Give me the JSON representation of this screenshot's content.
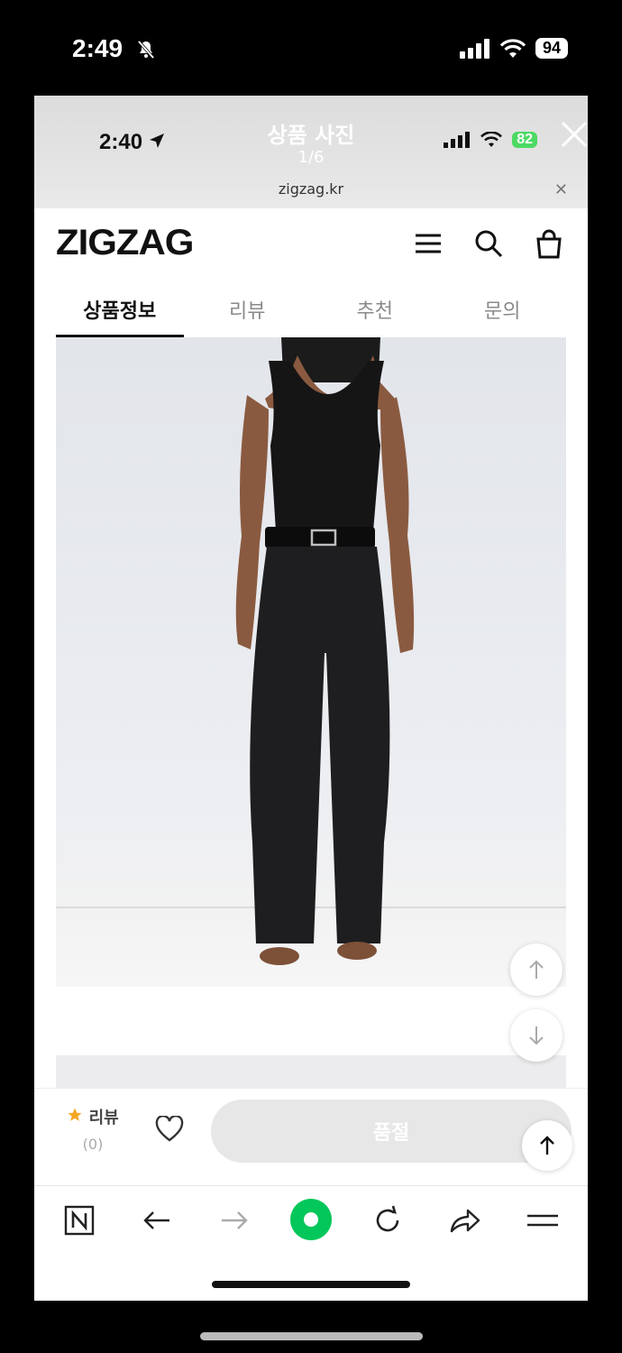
{
  "outer_status": {
    "time": "2:49",
    "battery": "94"
  },
  "viewer": {
    "time": "2:40",
    "title": "상품 사진",
    "counter": "1/6",
    "battery": "82",
    "url": "zigzag.kr"
  },
  "site": {
    "logo": "ZIGZAG",
    "tabs": [
      {
        "label": "상품정보"
      },
      {
        "label": "리뷰"
      },
      {
        "label": "추천"
      },
      {
        "label": "문의"
      }
    ],
    "active_tab": "상품정보"
  },
  "action_bar": {
    "review_label": "리뷰",
    "review_count": "(0)",
    "soldout_label": "품절",
    "star_color": "#f5a623"
  },
  "browser_bar": {
    "icons": [
      "naver-n-icon",
      "back-arrow-icon",
      "forward-arrow-icon",
      "green-dot-icon",
      "refresh-icon",
      "share-icon",
      "menu-icon"
    ],
    "accent": "#03c75a"
  }
}
